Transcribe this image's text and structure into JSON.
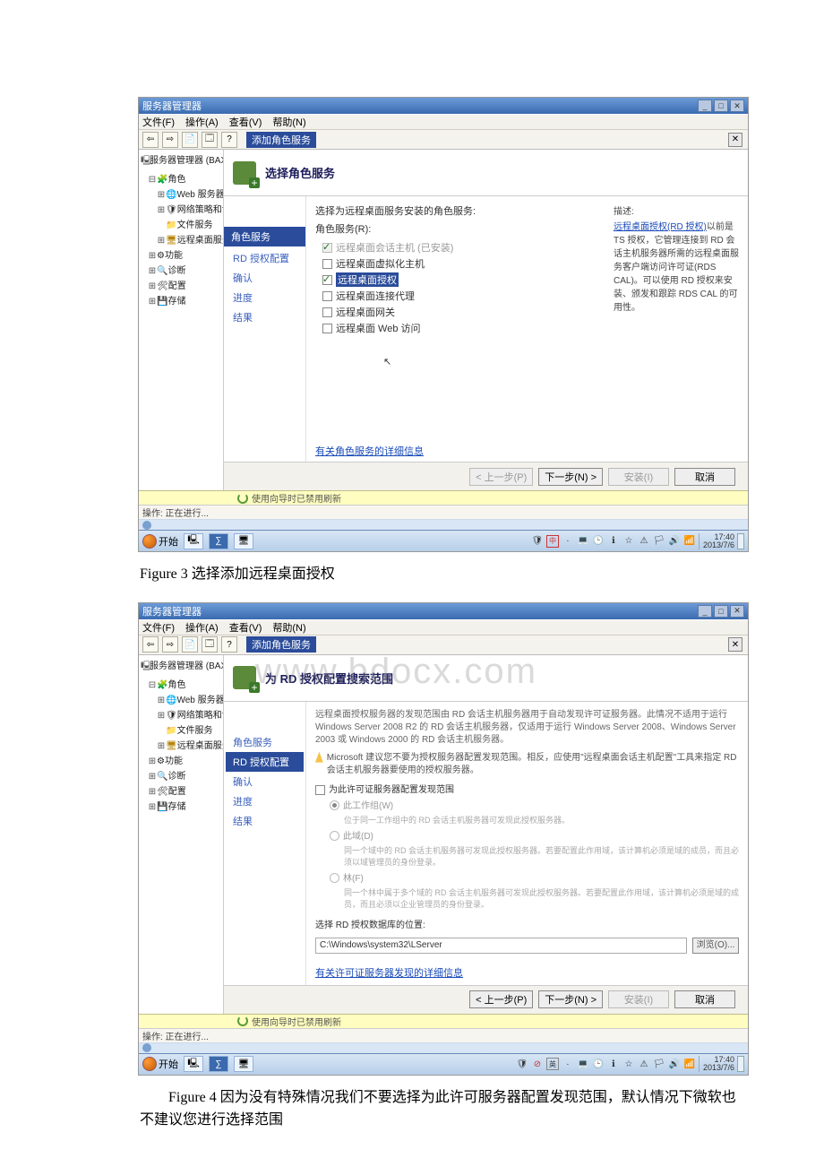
{
  "titlebar": {
    "title": "服务器管理器",
    "min": "_",
    "max": "□",
    "close": "✕"
  },
  "menubar": {
    "file": "文件(F)",
    "action": "操作(A)",
    "view": "查看(V)",
    "help": "帮助(N)"
  },
  "toolbar": {
    "badge": "添加角色服务"
  },
  "tree": {
    "root": "服务器管理器 (BAXSERVE",
    "roles": "角色",
    "web": "Web 服务器(IIS)",
    "np": "网络策略和访问服",
    "fs": "文件服务",
    "rd": "远程桌面服务",
    "func": "功能",
    "diag": "诊断",
    "cfg": "配置",
    "store": "存储"
  },
  "wizard1": {
    "title": "选择角色服务",
    "step_header": "角色服务",
    "steps": [
      "RD 授权配置",
      "确认",
      "进度",
      "结果"
    ],
    "prompt": "选择为远程桌面服务安装的角色服务:",
    "roles_label": "角色服务(R):",
    "roles": [
      {
        "label": "远程桌面会话主机   (已安装)",
        "checked": true,
        "disabled": true
      },
      {
        "label": "远程桌面虚拟化主机",
        "checked": false
      },
      {
        "label": "远程桌面授权",
        "checked": true,
        "selected": true
      },
      {
        "label": "远程桌面连接代理",
        "checked": false
      },
      {
        "label": "远程桌面网关",
        "checked": false
      },
      {
        "label": "远程桌面 Web 访问",
        "checked": false
      }
    ],
    "desc_head": "描述:",
    "desc_link": "远程桌面授权(RD 授权)",
    "desc_body": "以前是 TS 授权，它管理连接到 RD 会话主机服务器所需的远程桌面服务客户端访问许可证(RDS CAL)。可以使用 RD 授权来安装、颁发和跟踪 RDS CAL 的可用性。",
    "more_link": "有关角色服务的详细信息",
    "btn_back": "< 上一步(P)",
    "btn_next": "下一步(N) >",
    "btn_install": "安装(I)",
    "btn_cancel": "取消"
  },
  "wizard2": {
    "title": "为 RD 授权配置搜索范围",
    "step_header": "角色服务",
    "steps": [
      {
        "label": "RD 授权配置",
        "sel": true
      },
      {
        "label": "确认",
        "sel": false
      },
      {
        "label": "进度",
        "sel": false
      },
      {
        "label": "结果",
        "sel": false
      }
    ],
    "para1": "远程桌面授权服务器的发现范围由 RD 会话主机服务器用于自动发现许可证服务器。此情况不适用于运行 Windows Server 2008 R2 的 RD 会话主机服务器，仅适用于运行 Windows Server 2008、Windows Server 2003 或 Windows 2000 的 RD 会话主机服务器。",
    "warn": "Microsoft 建议您不要为授权服务器配置发现范围。相反，应使用\"远程桌面会话主机配置\"工具来指定 RD 会话主机服务器要使用的授权服务器。",
    "chk_label": "为此许可证服务器配置发现范围",
    "radio1": "此工作组(W)",
    "radio1_sub": "位于同一工作组中的 RD 会话主机服务器可发现此授权服务器。",
    "radio2": "此域(D)",
    "radio2_sub": "同一个域中的 RD 会话主机服务器可发现此授权服务器。若要配置此作用域，该计算机必须是域的成员，而且必须以域管理员的身份登录。",
    "radio3": "林(F)",
    "radio3_sub": "同一个林中属于多个域的 RD 会话主机服务器可发现此授权服务器。若要配置此作用域，该计算机必须是域的成员，而且必须以企业管理员的身份登录。",
    "db_label": "选择 RD 授权数据库的位置:",
    "db_path": "C:\\Windows\\system32\\LServer",
    "browse": "浏览(O)...",
    "more_link": "有关许可证服务器发现的详细信息",
    "btn_back": "< 上一步(P)",
    "btn_next": "下一步(N) >",
    "btn_install": "安装(I)",
    "btn_cancel": "取消"
  },
  "status": {
    "refresh_msg": "使用向导时已禁用刷新"
  },
  "action_bar": {
    "text": "操作: 正在进行..."
  },
  "taskbar": {
    "start": "开始",
    "time": "17:40",
    "date": "2013/7/6",
    "ime1": "中",
    "ime2": "英"
  },
  "figure3": {
    "label": "Figure 3 ",
    "caption": "选择添加远程桌面授权"
  },
  "figure4": {
    "label": "Figure 4 ",
    "caption": "因为没有特殊情况我们不要选择为此许可服务器配置发现范围，默认情况下微软也不建议您进行选择范围"
  },
  "watermark": {
    "text": "www.bdocx.com"
  }
}
